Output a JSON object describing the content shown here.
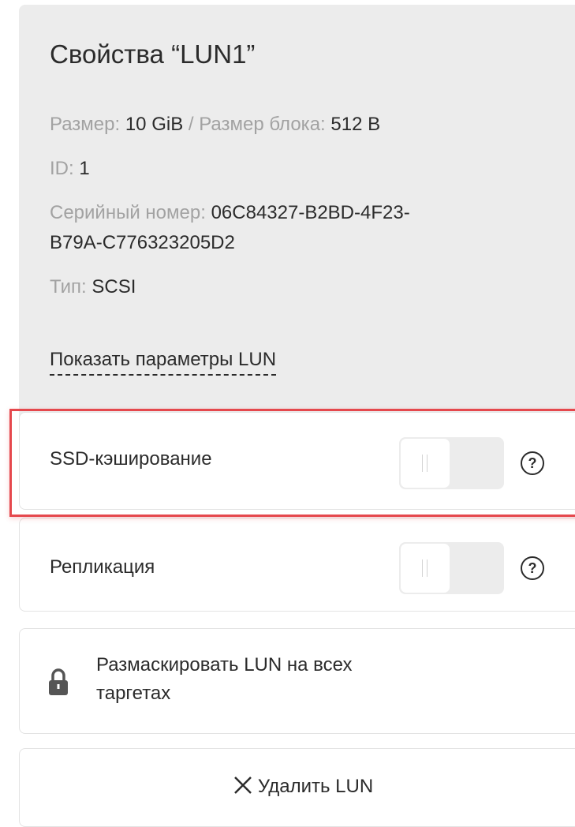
{
  "properties": {
    "title": "Свойства “LUN1”",
    "size_label": "Размер:",
    "size_value": "10 GiB",
    "separator": "/",
    "block_size_label": "Размер блока:",
    "block_size_value": "512 B",
    "id_label": "ID:",
    "id_value": "1",
    "serial_label": "Серийный номер:",
    "serial_value_part1": "06C84327-B2BD-4F23-",
    "serial_value_part2": "B79A-C776323205D2",
    "type_label": "Тип:",
    "type_value": "SCSI",
    "show_params_link": "Показать параметры LUN"
  },
  "settings": [
    {
      "label": "SSD-кэширование",
      "toggle_on": false,
      "highlighted": true,
      "help_icon": "question-circle-icon"
    },
    {
      "label": "Репликация",
      "toggle_on": false,
      "highlighted": false,
      "help_icon": "question-circle-icon"
    }
  ],
  "actions": {
    "unmask_label_line1": "Размаскировать LUN на всех",
    "unmask_label_line2": "таргетах",
    "unmask_icon": "lock-icon",
    "delete_label": "Удалить LUN",
    "delete_icon": "close-icon"
  },
  "colors": {
    "panel_bg": "#ececec",
    "muted_text": "#a2a2a2",
    "text": "#2b2b2b",
    "highlight_border": "#e5484d"
  }
}
